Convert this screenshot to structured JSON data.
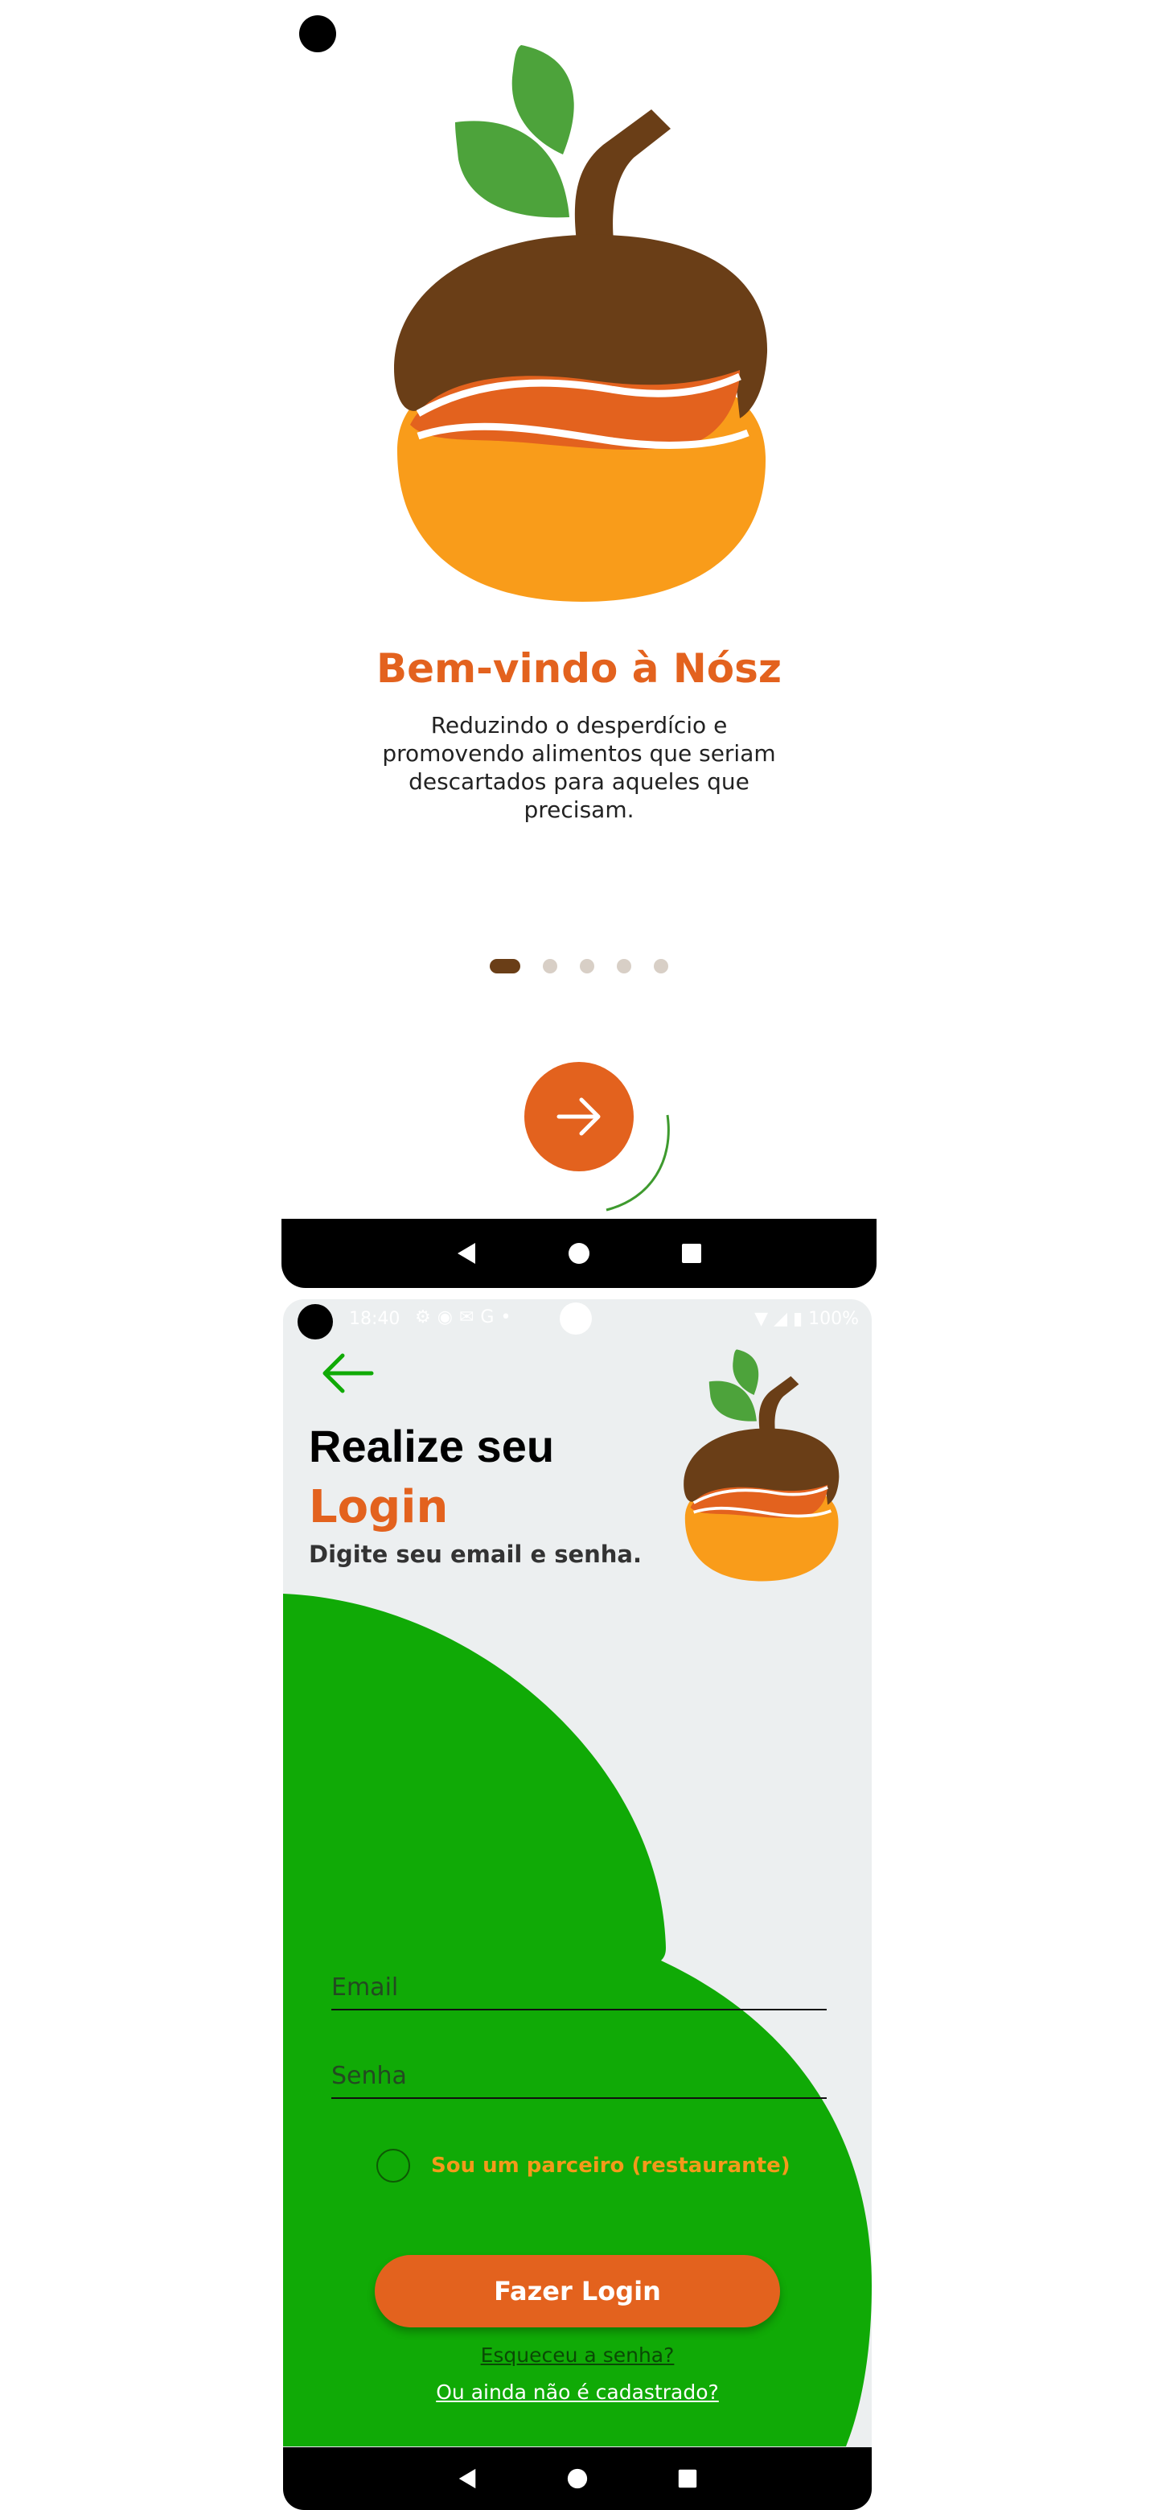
{
  "welcome": {
    "title": "Bem-vindo à Nósz",
    "description": "Reduzindo o desperdício e promovendo alimentos que seriam descartados para aqueles que precisam.",
    "pager": {
      "total": 5,
      "active_index": 0
    },
    "next_icon": "arrow-right-icon"
  },
  "status_bar": {
    "time": "18:40",
    "left_icons": [
      "settings-icon",
      "notification-icon",
      "mail-icon",
      "google-icon",
      "dot-icon"
    ],
    "right_text": "100%",
    "right_icons": [
      "wifi-icon",
      "signal-icon",
      "battery-icon"
    ]
  },
  "login": {
    "title_line1": "Realize seu",
    "title_line2": "Login",
    "subtitle": "Digite seu email e senha.",
    "email_placeholder": "Email",
    "password_placeholder": "Senha",
    "partner_label": "Sou um parceiro (restaurante)",
    "submit_label": "Fazer Login",
    "forgot_label": "Esqueceu a senha?",
    "register_label": "Ou ainda não é cadastrado?"
  },
  "navigation": {
    "buttons": [
      "back-triangle-icon",
      "home-circle-icon",
      "recents-square-icon"
    ]
  },
  "colors": {
    "brand_orange": "#E3621E",
    "brand_brown": "#6A3E17",
    "brand_green": "#10AA06",
    "leaf_green": "#4DA33B",
    "fruit_orange": "#F99C1A",
    "accent_yellow": "#F39A1A",
    "login_background": "#ECEFF0"
  }
}
